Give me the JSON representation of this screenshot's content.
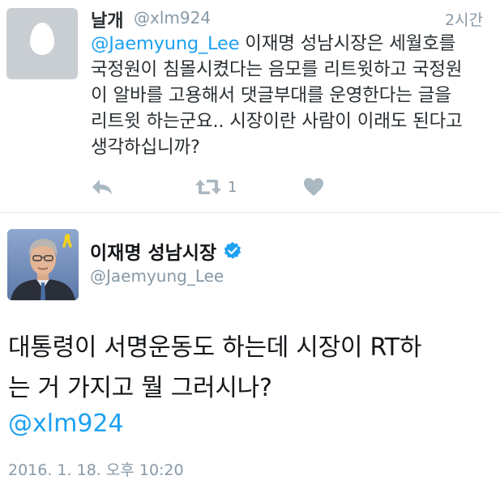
{
  "reply_tweet": {
    "display_name": "날개",
    "handle": "@xlm924",
    "timestamp": "2시간",
    "avatar_icon": "default-egg-avatar-icon",
    "text": {
      "mention": "@Jaemyung_Lee",
      "line1_rest": " 이재명 성남시장은 세월호를",
      "line2": "국정원이 침몰시켰다는 음모를 리트윗하고 국정원",
      "line3": "이 알바를 고용해서 댓글부대를 운영한다는 글을",
      "line4": "리트윗 하는군요.. 시장이란 사람이 이래도 된다고",
      "line5": "생각하십니까?"
    },
    "actions": {
      "reply_icon": "reply-arrow-icon",
      "retweet_icon": "retweet-icon",
      "retweet_count": "1",
      "like_icon": "heart-icon"
    },
    "colors": {
      "action_icon": "#aab8c2",
      "secondary_text": "#8899a6",
      "mention": "#1da1f2"
    }
  },
  "main_tweet": {
    "display_name": "이재명 성남시장",
    "verified_icon": "verified-badge-icon",
    "handle": "@Jaemyung_Lee",
    "avatar": "profile-photo",
    "text": {
      "line1": "대통령이 서명운동도 하는데 시장이 RT하",
      "line2": "는 거 가지고 뭘 그러시나?"
    },
    "mention": "@xlm924",
    "date": "2016. 1. 18. 오후 10:20",
    "colors": {
      "verified": "#1da1f2",
      "mention": "#1da1f2",
      "date": "#8899a6"
    }
  }
}
